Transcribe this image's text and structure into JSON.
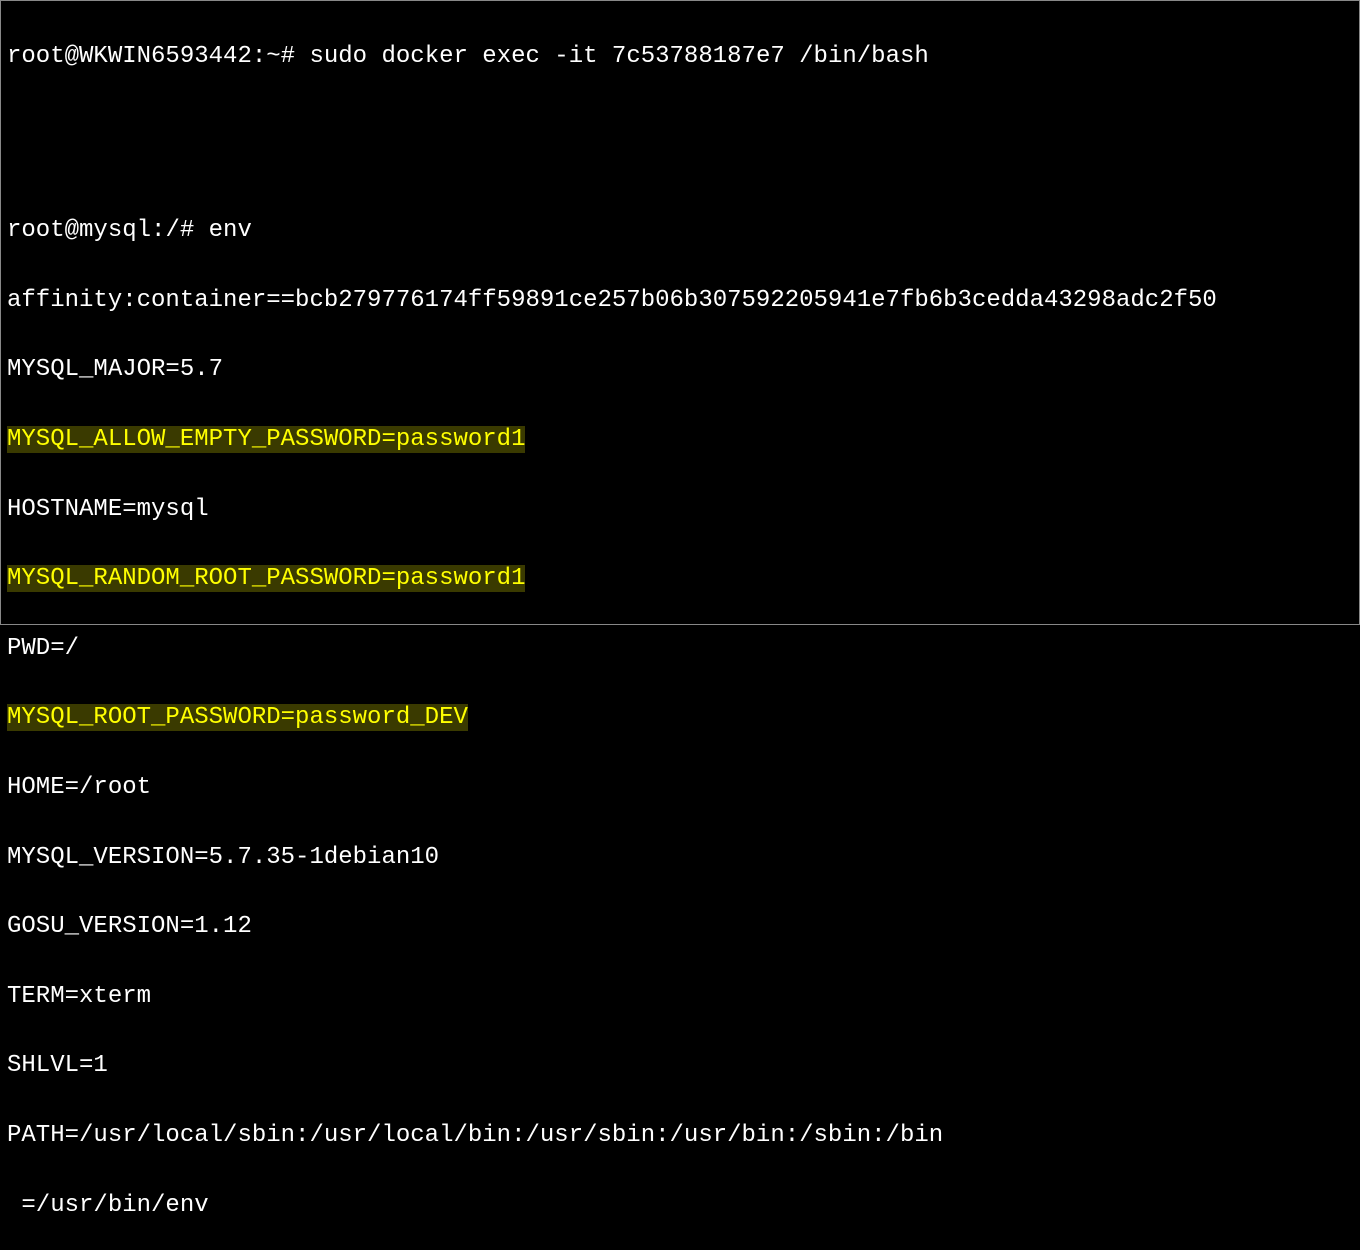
{
  "terminal": {
    "prompt1_user_host": "root@WKWIN6593442",
    "prompt1_path": "~",
    "prompt1_symbol": "#",
    "command1": "sudo docker exec -it 7c53788187e7 /bin/bash",
    "prompt2_user_host": "root@mysql",
    "prompt2_path": "/",
    "prompt2_symbol": "#",
    "command2": "env",
    "env_lines": {
      "l0": "affinity:container==bcb279776174ff59891ce257b06b307592205941e7fb6b3cedda43298adc2f50",
      "l1": "MYSQL_MAJOR=5.7",
      "l2": "MYSQL_ALLOW_EMPTY_PASSWORD=password1",
      "l3": "HOSTNAME=mysql",
      "l4": "MYSQL_RANDOM_ROOT_PASSWORD=password1",
      "l5": "PWD=/",
      "l6": "MYSQL_ROOT_PASSWORD=password_DEV",
      "l7": "HOME=/root",
      "l8": "MYSQL_VERSION=5.7.35-1debian10",
      "l9": "GOSU_VERSION=1.12",
      "l10": "TERM=xterm",
      "l11": "SHLVL=1",
      "l12": "PATH=/usr/local/sbin:/usr/local/bin:/usr/sbin:/usr/bin:/sbin:/bin",
      "l13": " =/usr/bin/env"
    }
  }
}
